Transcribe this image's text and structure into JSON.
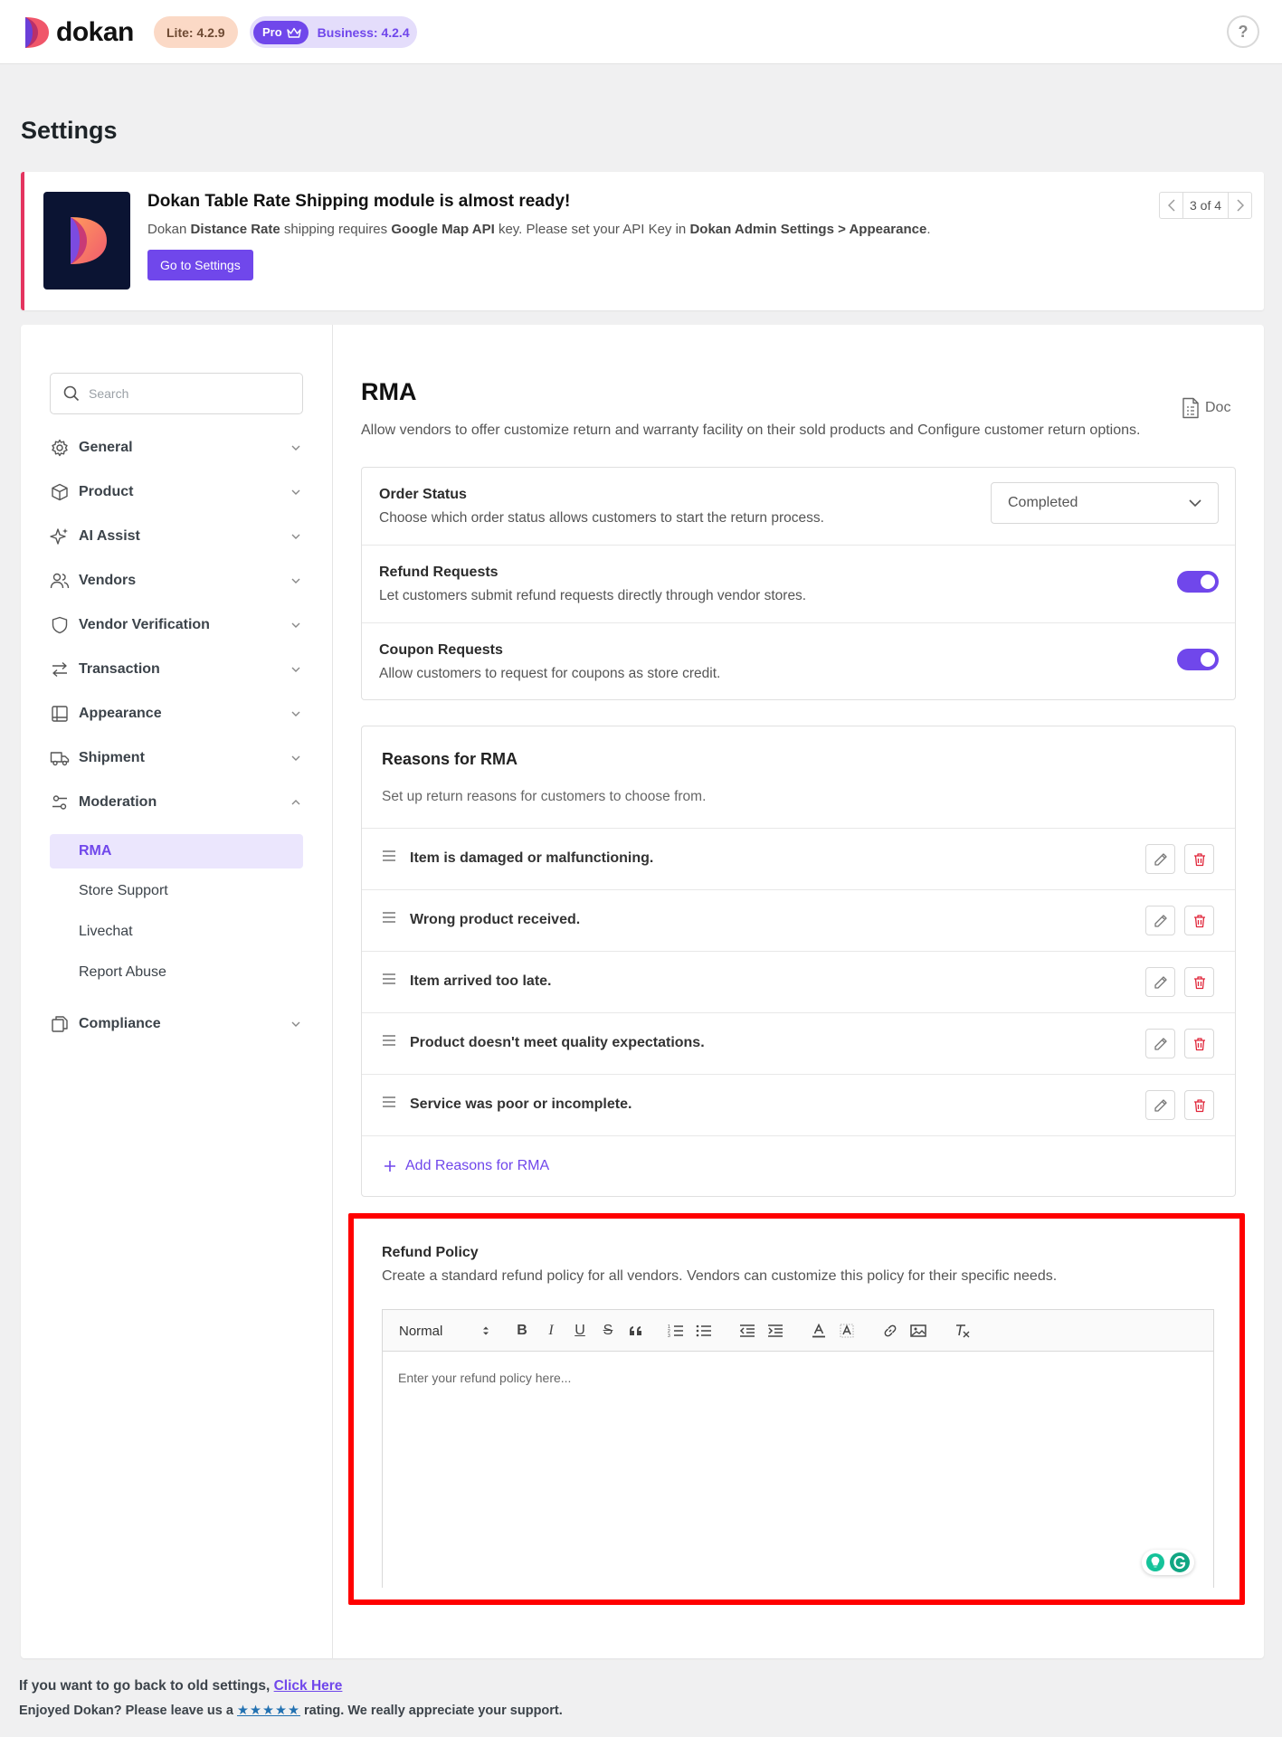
{
  "header": {
    "brand": "dokan",
    "lite_badge": "Lite: 4.2.9",
    "pro_label": "Pro",
    "business_badge": "Business: 4.2.4",
    "help_symbol": "?"
  },
  "page_title": "Settings",
  "notice": {
    "title": "Dokan Table Rate Shipping module is almost ready!",
    "text_prefix": "Dokan ",
    "text_bold1": "Distance Rate",
    "text_mid1": " shipping requires ",
    "text_bold2": "Google Map API",
    "text_mid2": " key. Please set your API Key in ",
    "text_bold3": "Dokan Admin Settings > Appearance",
    "text_suffix": ".",
    "button": "Go to Settings",
    "pager": "3 of 4",
    "accent_color": "#e4345f"
  },
  "sidebar": {
    "search_placeholder": "Search",
    "items": [
      {
        "label": "General",
        "icon": "gear-icon"
      },
      {
        "label": "Product",
        "icon": "box-icon"
      },
      {
        "label": "AI Assist",
        "icon": "sparkle-icon"
      },
      {
        "label": "Vendors",
        "icon": "users-icon"
      },
      {
        "label": "Vendor Verification",
        "icon": "shield-icon"
      },
      {
        "label": "Transaction",
        "icon": "transfer-icon"
      },
      {
        "label": "Appearance",
        "icon": "book-icon"
      },
      {
        "label": "Shipment",
        "icon": "truck-icon"
      },
      {
        "label": "Moderation",
        "icon": "sliders-icon"
      },
      {
        "label": "Compliance",
        "icon": "copy-icon"
      }
    ],
    "moderation_sub": [
      "RMA",
      "Store Support",
      "Livechat",
      "Report Abuse"
    ],
    "active_sub": "RMA"
  },
  "content": {
    "title": "RMA",
    "doc_label": "Doc",
    "description": "Allow vendors to offer customize return and warranty facility on their sold products and Configure customer return options.",
    "settings": [
      {
        "title": "Order Status",
        "desc": "Choose which order status allows customers to start the return process.",
        "control": "select",
        "value": "Completed"
      },
      {
        "title": "Refund Requests",
        "desc": "Let customers submit refund requests directly through vendor stores.",
        "control": "toggle",
        "on": true
      },
      {
        "title": "Coupon Requests",
        "desc": "Allow customers to request for coupons as store credit.",
        "control": "toggle",
        "on": true
      }
    ],
    "reasons": {
      "title": "Reasons for RMA",
      "subtitle": "Set up return reasons for customers to choose from.",
      "items": [
        "Item is damaged or malfunctioning.",
        "Wrong product received.",
        "Item arrived too late.",
        "Product doesn't meet quality expectations.",
        "Service was poor or incomplete."
      ],
      "add_label": "Add Reasons for RMA"
    },
    "refund_policy": {
      "title": "Refund Policy",
      "desc": "Create a standard refund policy for all vendors. Vendors can customize this policy for their specific needs.",
      "format_select": "Normal",
      "placeholder": "Enter your refund policy here..."
    }
  },
  "footer": {
    "old_settings_text": "If you want to go back to old settings, ",
    "old_settings_link": "Click Here",
    "rating_prefix": "Enjoyed Dokan? Please leave us a ",
    "rating_stars": "★★★★★",
    "rating_suffix": " rating. We really appreciate your support."
  },
  "colors": {
    "accent": "#7047eb",
    "highlight_border": "#ff0000",
    "delete_red": "#e0263a"
  }
}
